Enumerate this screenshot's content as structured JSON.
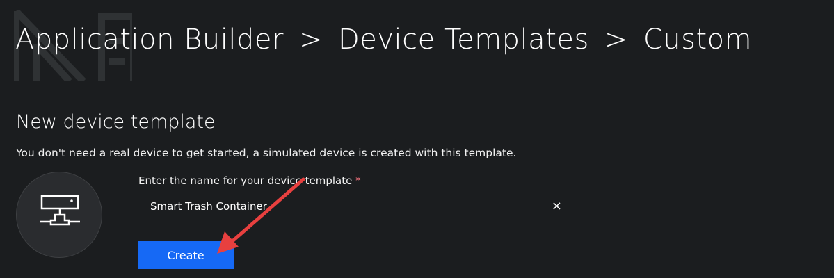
{
  "breadcrumb": {
    "items": [
      "Application Builder",
      "Device Templates",
      "Custom"
    ],
    "separator": ">"
  },
  "page": {
    "title": "New device template",
    "description": "You don't need a real device to get started, a simulated device is created with this template."
  },
  "form": {
    "name_label": "Enter the name for your device template",
    "required_marker": "*",
    "name_value": "Smart Trash Container",
    "clear_icon": "×",
    "create_label": "Create"
  },
  "colors": {
    "accent": "#1669f5",
    "background": "#1b1d1f",
    "annotation_arrow": "#e8403f"
  }
}
